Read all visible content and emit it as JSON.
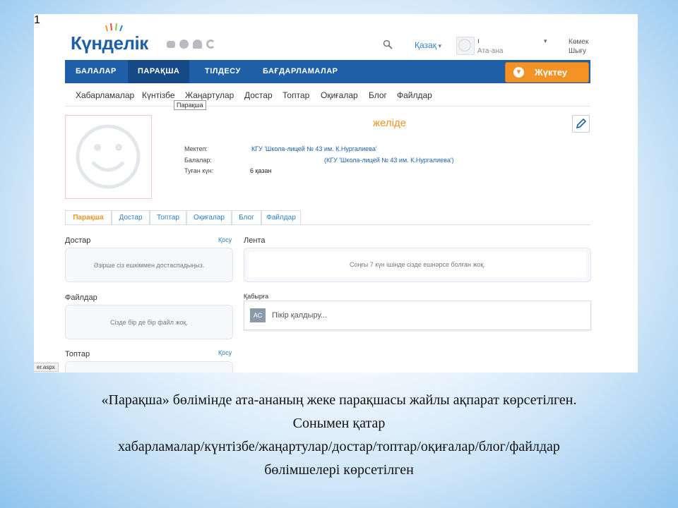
{
  "header": {
    "logo_text": "Күнделік",
    "notification_count": "1",
    "language": "Қазақ",
    "user_name": "ı",
    "user_role": "Ата-ана",
    "help": "Көмек",
    "logout": "Шығу"
  },
  "nav": {
    "items": [
      "БАЛАЛАР",
      "ПАРАҚША",
      "ТІЛДЕСУ",
      "БАҒДАРЛАМАЛАР"
    ],
    "active": "ПАРАҚША",
    "upload_label": "Жүктеу"
  },
  "subnav": {
    "items": [
      "Хабарламалар",
      "Күнтізбе",
      "Жаңартулар",
      "Достар",
      "Топтар",
      "Оқиғалар",
      "Блог",
      "Файлдар"
    ],
    "tooltip": "Парақша"
  },
  "profile": {
    "status": "желіде",
    "school_label": "Мектеп:",
    "school_value": "КГУ 'Школа-лицей № 43 им. К.Нургалиева'",
    "children_label": "Балалар:",
    "children_value": "(КГУ 'Школа-лицей № 43 им. К.Нургалиева')",
    "birthday_label": "Туған күн:",
    "birthday_value": "6 қазан"
  },
  "tabs": [
    "Парақша",
    "Достар",
    "Топтар",
    "Оқиғалар",
    "Блог",
    "Файлдар"
  ],
  "active_tab": "Парақша",
  "left": {
    "friends_title": "Достар",
    "friends_add": "Қосу",
    "friends_empty": "Әзірше сіз ешкіммен достаспадыңыз.",
    "files_title": "Файлдар",
    "files_empty": "Сізде бір де бір файл жоқ.",
    "groups_title": "Топтар",
    "groups_add": "Қосу"
  },
  "right": {
    "feed_title": "Лента",
    "feed_empty": "Соңғы 7 күн ішінде сізде ешнәрсе болған жоқ.",
    "wall_title": "Қабырға",
    "avatar_initials": "АС",
    "comment_placeholder": "Пікір қалдыру..."
  },
  "status_bar_url": "er.aspx",
  "caption": {
    "line1": "«Парақша» бөлімінде ата-ананың жеке парақшасы жайлы ақпарат көрсетілген.",
    "line2": "Сонымен қатар",
    "line3": "хабарламалар/күнтізбе/жаңартулар/достар/топтар/оқиғалар/блог/файлдар",
    "line4": "бөлімшелері көрсетілген"
  },
  "colors": {
    "brand_blue": "#1e5fa8",
    "accent_orange": "#f39325",
    "link_blue": "#2e7dc2"
  }
}
